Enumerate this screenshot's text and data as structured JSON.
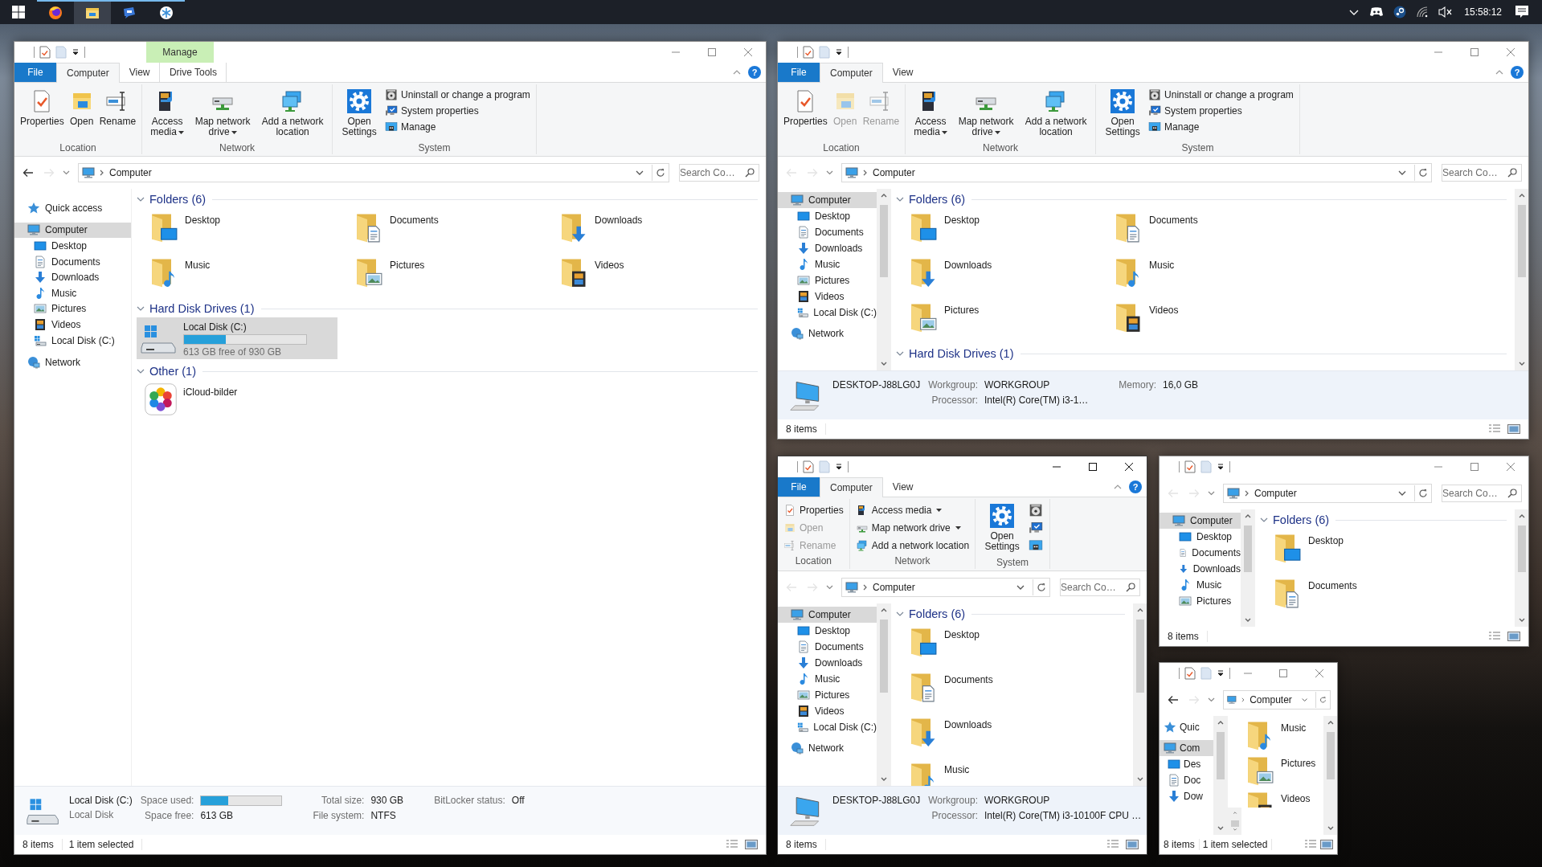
{
  "taskbar": {
    "apps": [
      {
        "kind": "globe",
        "selected": false
      },
      {
        "kind": "folder",
        "selected": true
      },
      {
        "kind": "chat",
        "selected": false
      },
      {
        "kind": "snowflake",
        "selected": false
      }
    ],
    "clock": "15:58:12"
  },
  "windows": [
    {
      "active": false,
      "context_label": "Manage",
      "ribbon": {
        "kind": "large",
        "help": "?",
        "tabs": [
          {
            "label": "File",
            "kind": "file",
            "selected": false
          },
          {
            "label": "Computer",
            "kind": "normal",
            "selected": true
          },
          {
            "label": "View",
            "kind": "normal",
            "selected": false
          },
          {
            "label": "Drive Tools",
            "kind": "context",
            "selected": false
          }
        ],
        "groups": [
          {
            "label": "Location",
            "buttons": [
              {
                "kind": "large",
                "label": "Properties",
                "disabled": false,
                "dropdown": false
              },
              {
                "kind": "large",
                "label": "Open",
                "disabled": false,
                "dropdown": false
              },
              {
                "kind": "large",
                "label": "Rename",
                "disabled": false,
                "dropdown": false
              }
            ]
          },
          {
            "label": "Network",
            "buttons": [
              {
                "kind": "large",
                "label": "Access media",
                "disabled": false,
                "dropdown": true
              },
              {
                "kind": "large",
                "label": "Map network drive",
                "disabled": false,
                "dropdown": true
              },
              {
                "kind": "large",
                "label": "Add a network location",
                "disabled": false,
                "dropdown": false
              }
            ]
          },
          {
            "label": "System",
            "buttons": [
              {
                "kind": "large",
                "label": "Open Settings",
                "disabled": false,
                "dropdown": false
              },
              {
                "kind": "small",
                "label": "Uninstall or change a program",
                "disabled": false,
                "dropdown": false
              },
              {
                "kind": "small",
                "label": "System properties",
                "disabled": false,
                "dropdown": false
              },
              {
                "kind": "small",
                "label": "Manage",
                "disabled": false,
                "dropdown": false
              }
            ]
          }
        ]
      },
      "address": {
        "path": "Computer",
        "search_placeholder": "Search Co…",
        "back_disabled": false,
        "forward_disabled": true
      },
      "nav": [
        {
          "label": "Quick access",
          "kind": "quick",
          "selected": false
        },
        {
          "label": "Computer",
          "kind": "computer",
          "selected": true,
          "children": [
            {
              "label": "Desktop",
              "kind": "desktop",
              "selected": false
            },
            {
              "label": "Documents",
              "kind": "documents",
              "selected": false
            },
            {
              "label": "Downloads",
              "kind": "downloads",
              "selected": false
            },
            {
              "label": "Music",
              "kind": "music",
              "selected": false
            },
            {
              "label": "Pictures",
              "kind": "pictures",
              "selected": false
            },
            {
              "label": "Videos",
              "kind": "videos",
              "selected": false
            },
            {
              "label": "Local Disk (C:)",
              "kind": "drive",
              "selected": false
            }
          ]
        },
        {
          "label": "Network",
          "kind": "network",
          "selected": false
        }
      ],
      "sections": [
        {
          "title": "Folders (6)",
          "expanded": true,
          "items": [
            {
              "label": "Desktop",
              "kind": "desktop",
              "selected": false
            },
            {
              "label": "Documents",
              "kind": "documents",
              "selected": false
            },
            {
              "label": "Downloads",
              "kind": "downloads",
              "selected": false
            },
            {
              "label": "Music",
              "kind": "music",
              "selected": false
            },
            {
              "label": "Pictures",
              "kind": "pictures",
              "selected": false
            },
            {
              "label": "Videos",
              "kind": "videos",
              "selected": false
            }
          ]
        },
        {
          "title": "Hard Disk Drives (1)",
          "expanded": true,
          "items": [
            {
              "label": "Local Disk (C:)",
              "kind": "drive",
              "selected": true,
              "level": 0.34,
              "caption": "613 GB free of 930 GB"
            }
          ]
        },
        {
          "title": "Other (1)",
          "expanded": true,
          "items": [
            {
              "label": "iCloud-bilder",
              "kind": "app",
              "selected": false
            }
          ]
        }
      ],
      "details": {
        "kind": "drive",
        "name": "Local Disk (C:)",
        "subtitle": "Local Disk",
        "fields": [
          {
            "label": "Space used:",
            "kind": "bar",
            "level": 0.34
          },
          {
            "label": "Total size:",
            "kind": "text",
            "value": "930 GB"
          },
          {
            "label": "BitLocker status:",
            "kind": "text",
            "value": "Off"
          },
          {
            "label": "Space free:",
            "kind": "text",
            "value": "613 GB"
          },
          {
            "label": "File system:",
            "kind": "text",
            "value": "NTFS"
          }
        ]
      },
      "status": [
        "8 items",
        "1 item selected"
      ]
    },
    {
      "active": false,
      "ribbon": {
        "kind": "large",
        "help": "?",
        "tabs": [
          {
            "label": "File",
            "kind": "file",
            "selected": false
          },
          {
            "label": "Computer",
            "kind": "normal",
            "selected": true
          },
          {
            "label": "View",
            "kind": "normal",
            "selected": false
          }
        ],
        "groups": [
          {
            "label": "Location",
            "buttons": [
              {
                "kind": "large",
                "label": "Properties",
                "disabled": false,
                "dropdown": false
              },
              {
                "kind": "large",
                "label": "Open",
                "disabled": true,
                "dropdown": false
              },
              {
                "kind": "large",
                "label": "Rename",
                "disabled": true,
                "dropdown": false
              }
            ]
          },
          {
            "label": "Network",
            "buttons": [
              {
                "kind": "large",
                "label": "Access media",
                "disabled": false,
                "dropdown": true
              },
              {
                "kind": "large",
                "label": "Map network drive",
                "disabled": false,
                "dropdown": true
              },
              {
                "kind": "large",
                "label": "Add a network location",
                "disabled": false,
                "dropdown": false
              }
            ]
          },
          {
            "label": "System",
            "buttons": [
              {
                "kind": "large",
                "label": "Open Settings",
                "disabled": false,
                "dropdown": false
              },
              {
                "kind": "small",
                "label": "Uninstall or change a program",
                "disabled": false,
                "dropdown": false
              },
              {
                "kind": "small",
                "label": "System properties",
                "disabled": false,
                "dropdown": false
              },
              {
                "kind": "small",
                "label": "Manage",
                "disabled": false,
                "dropdown": false
              }
            ]
          }
        ]
      },
      "address": {
        "path": "Computer",
        "search_placeholder": "Search Co…",
        "back_disabled": true,
        "forward_disabled": true
      },
      "nav": [
        {
          "label": "Computer",
          "kind": "computer",
          "selected": true,
          "children": [
            {
              "label": "Desktop",
              "kind": "desktop",
              "selected": false
            },
            {
              "label": "Documents",
              "kind": "documents",
              "selected": false
            },
            {
              "label": "Downloads",
              "kind": "downloads",
              "selected": false
            },
            {
              "label": "Music",
              "kind": "music",
              "selected": false
            },
            {
              "label": "Pictures",
              "kind": "pictures",
              "selected": false
            },
            {
              "label": "Videos",
              "kind": "videos",
              "selected": false
            },
            {
              "label": "Local Disk (C:)",
              "kind": "drive",
              "selected": false
            }
          ]
        },
        {
          "label": "Network",
          "kind": "network",
          "selected": false
        }
      ],
      "sections": [
        {
          "title": "Folders (6)",
          "expanded": true,
          "items": [
            {
              "label": "Desktop",
              "kind": "desktop",
              "selected": false
            },
            {
              "label": "Documents",
              "kind": "documents",
              "selected": false
            },
            {
              "label": "Downloads",
              "kind": "downloads",
              "selected": false
            },
            {
              "label": "Music",
              "kind": "music",
              "selected": false
            },
            {
              "label": "Pictures",
              "kind": "pictures",
              "selected": false
            },
            {
              "label": "Videos",
              "kind": "videos",
              "selected": false
            }
          ]
        },
        {
          "title": "Hard Disk Drives (1)",
          "expanded": true
        }
      ],
      "details": {
        "kind": "computer",
        "name": "DESKTOP-J88LG0J",
        "fields": [
          {
            "label": "Workgroup:",
            "kind": "text",
            "value": "WORKGROUP"
          },
          {
            "label": "Memory:",
            "kind": "text",
            "value": "16,0 GB"
          },
          {
            "label": "Processor:",
            "kind": "text",
            "value": "Intel(R) Core(TM) i3-1…"
          }
        ]
      },
      "status": [
        "8 items"
      ]
    },
    {
      "active": true,
      "ribbon": {
        "kind": "compact",
        "help": "?",
        "tabs": [
          {
            "label": "File",
            "kind": "file",
            "selected": false
          },
          {
            "label": "Computer",
            "kind": "normal",
            "selected": true
          },
          {
            "label": "View",
            "kind": "normal",
            "selected": false
          }
        ],
        "groups": [
          {
            "label": "Location",
            "buttons": [
              {
                "kind": "small",
                "label": "Properties",
                "disabled": false,
                "dropdown": false
              },
              {
                "kind": "small",
                "label": "Open",
                "disabled": true,
                "dropdown": false
              },
              {
                "kind": "small",
                "label": "Rename",
                "disabled": true,
                "dropdown": false
              }
            ]
          },
          {
            "label": "Network",
            "buttons": [
              {
                "kind": "small",
                "label": "Access media",
                "disabled": false,
                "dropdown": true
              },
              {
                "kind": "small",
                "label": "Map network drive",
                "disabled": false,
                "dropdown": true
              },
              {
                "kind": "small",
                "label": "Add a network location",
                "disabled": false,
                "dropdown": false
              }
            ]
          },
          {
            "label": "System",
            "buttons": [
              {
                "kind": "large",
                "label": "Open Settings",
                "disabled": false,
                "dropdown": false
              },
              {
                "kind": "icon",
                "disabled": false,
                "dropdown": false
              },
              {
                "kind": "icon",
                "disabled": false,
                "dropdown": false
              },
              {
                "kind": "icon",
                "disabled": false,
                "dropdown": false
              }
            ]
          }
        ]
      },
      "address": {
        "path": "Computer",
        "search_placeholder": "Search Co…",
        "back_disabled": true,
        "forward_disabled": true
      },
      "nav": [
        {
          "label": "Computer",
          "kind": "computer",
          "selected": true,
          "children": [
            {
              "label": "Desktop",
              "kind": "desktop",
              "selected": false
            },
            {
              "label": "Documents",
              "kind": "documents",
              "selected": false
            },
            {
              "label": "Downloads",
              "kind": "downloads",
              "selected": false
            },
            {
              "label": "Music",
              "kind": "music",
              "selected": false
            },
            {
              "label": "Pictures",
              "kind": "pictures",
              "selected": false
            },
            {
              "label": "Videos",
              "kind": "videos",
              "selected": false
            },
            {
              "label": "Local Disk (C:)",
              "kind": "drive",
              "selected": false
            }
          ]
        },
        {
          "label": "Network",
          "kind": "network",
          "selected": false
        }
      ],
      "sections": [
        {
          "title": "Folders (6)",
          "expanded": true,
          "items": [
            {
              "label": "Desktop",
              "kind": "desktop",
              "selected": false
            },
            {
              "label": "Documents",
              "kind": "documents",
              "selected": false
            },
            {
              "label": "Downloads",
              "kind": "downloads",
              "selected": false
            },
            {
              "label": "Music",
              "kind": "music",
              "selected": false
            }
          ]
        }
      ],
      "details": {
        "kind": "computer",
        "name": "DESKTOP-J88LG0J",
        "fields": [
          {
            "label": "Workgroup:",
            "kind": "text",
            "value": "WORKGROUP"
          },
          {
            "label": "Processor:",
            "kind": "text",
            "value": "Intel(R) Core(TM) i3-10100F CPU …"
          }
        ]
      },
      "status": [
        "8 items"
      ]
    },
    {
      "active": false,
      "address": {
        "path": "Computer",
        "search_placeholder": "Search Co…",
        "back_disabled": true,
        "forward_disabled": true
      },
      "nav": [
        {
          "label": "Computer",
          "kind": "computer",
          "selected": true,
          "children": [
            {
              "label": "Desktop",
              "kind": "desktop",
              "selected": false
            },
            {
              "label": "Documents",
              "kind": "documents",
              "selected": false
            },
            {
              "label": "Downloads",
              "kind": "downloads",
              "selected": false
            },
            {
              "label": "Music",
              "kind": "music",
              "selected": false
            },
            {
              "label": "Pictures",
              "kind": "pictures",
              "selected": false
            }
          ]
        }
      ],
      "sections": [
        {
          "title": "Folders (6)",
          "expanded": true,
          "items": [
            {
              "label": "Desktop",
              "kind": "desktop",
              "selected": false
            },
            {
              "label": "Documents",
              "kind": "documents",
              "selected": false
            }
          ]
        }
      ],
      "status": [
        "8 items"
      ]
    },
    {
      "active": false,
      "address": {
        "path": "Computer",
        "back_disabled": false,
        "forward_disabled": true
      },
      "nav": [
        {
          "label": "Quic",
          "kind": "quick",
          "selected": false
        },
        {
          "label": "Com",
          "kind": "computer",
          "selected": true,
          "children": [
            {
              "label": "Des",
              "kind": "desktop",
              "selected": false
            },
            {
              "label": "Doc",
              "kind": "documents",
              "selected": false
            },
            {
              "label": "Dow",
              "kind": "downloads",
              "selected": false
            }
          ]
        }
      ],
      "sections": [
        {
          "items": [
            {
              "label": "Music",
              "kind": "music",
              "selected": false
            },
            {
              "label": "Pictures",
              "kind": "pictures",
              "selected": false
            },
            {
              "label": "Videos",
              "kind": "videos",
              "selected": false
            }
          ]
        }
      ],
      "status": [
        "8 items",
        "1 item selected"
      ]
    }
  ]
}
